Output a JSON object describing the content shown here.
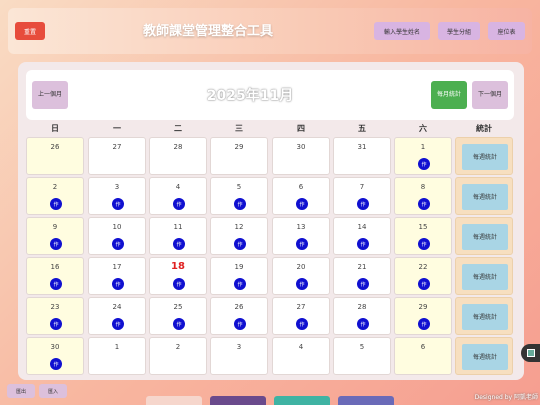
{
  "app": {
    "title": "教師課堂管理整合工具"
  },
  "toolbar": {
    "reset_label": "重置",
    "import_names_label": "輸入學生姓名",
    "group_students_label": "學生分組",
    "seating_chart_label": "座位表"
  },
  "calendar": {
    "month_title": "2025年11月",
    "prev_label": "上一個月",
    "next_label": "下一個月",
    "monthly_stats_label": "每月統計",
    "weekdays": [
      "日",
      "一",
      "二",
      "三",
      "四",
      "五",
      "六",
      "統計"
    ],
    "weekly_stats_label": "每週統計",
    "homework_badge": "作",
    "today": "18",
    "weeks": [
      [
        {
          "day": "26",
          "tag": false
        },
        {
          "day": "27",
          "tag": false
        },
        {
          "day": "28",
          "tag": false
        },
        {
          "day": "29",
          "tag": false
        },
        {
          "day": "30",
          "tag": false
        },
        {
          "day": "31",
          "tag": false
        },
        {
          "day": "1",
          "tag": true
        }
      ],
      [
        {
          "day": "2",
          "tag": true
        },
        {
          "day": "3",
          "tag": true
        },
        {
          "day": "4",
          "tag": true
        },
        {
          "day": "5",
          "tag": true
        },
        {
          "day": "6",
          "tag": true
        },
        {
          "day": "7",
          "tag": true
        },
        {
          "day": "8",
          "tag": true
        }
      ],
      [
        {
          "day": "9",
          "tag": true
        },
        {
          "day": "10",
          "tag": true
        },
        {
          "day": "11",
          "tag": true
        },
        {
          "day": "12",
          "tag": true
        },
        {
          "day": "13",
          "tag": true
        },
        {
          "day": "14",
          "tag": true
        },
        {
          "day": "15",
          "tag": true
        }
      ],
      [
        {
          "day": "16",
          "tag": true
        },
        {
          "day": "17",
          "tag": true
        },
        {
          "day": "18",
          "tag": true
        },
        {
          "day": "19",
          "tag": true
        },
        {
          "day": "20",
          "tag": true
        },
        {
          "day": "21",
          "tag": true
        },
        {
          "day": "22",
          "tag": true
        }
      ],
      [
        {
          "day": "23",
          "tag": true
        },
        {
          "day": "24",
          "tag": true
        },
        {
          "day": "25",
          "tag": true
        },
        {
          "day": "26",
          "tag": true
        },
        {
          "day": "27",
          "tag": true
        },
        {
          "day": "28",
          "tag": true
        },
        {
          "day": "29",
          "tag": true
        }
      ],
      [
        {
          "day": "30",
          "tag": true
        },
        {
          "day": "1",
          "tag": false
        },
        {
          "day": "2",
          "tag": false
        },
        {
          "day": "3",
          "tag": false
        },
        {
          "day": "4",
          "tag": false
        },
        {
          "day": "5",
          "tag": false
        },
        {
          "day": "6",
          "tag": false
        }
      ]
    ]
  },
  "footer": {
    "export_label": "匯出",
    "import_label": "匯入",
    "credit": "Designed by 阿凱老師",
    "theme_swatches": [
      "#f6d6cc",
      "#6a4a8c",
      "#3fb3a3",
      "#6a6ab8"
    ]
  },
  "colors": {
    "reset": "#e74c3c",
    "monthly_stats": "#4caf50",
    "homework_badge": "#1010d0",
    "today": "#e02020",
    "weekly_stats_btn": "#a9d5e5"
  }
}
